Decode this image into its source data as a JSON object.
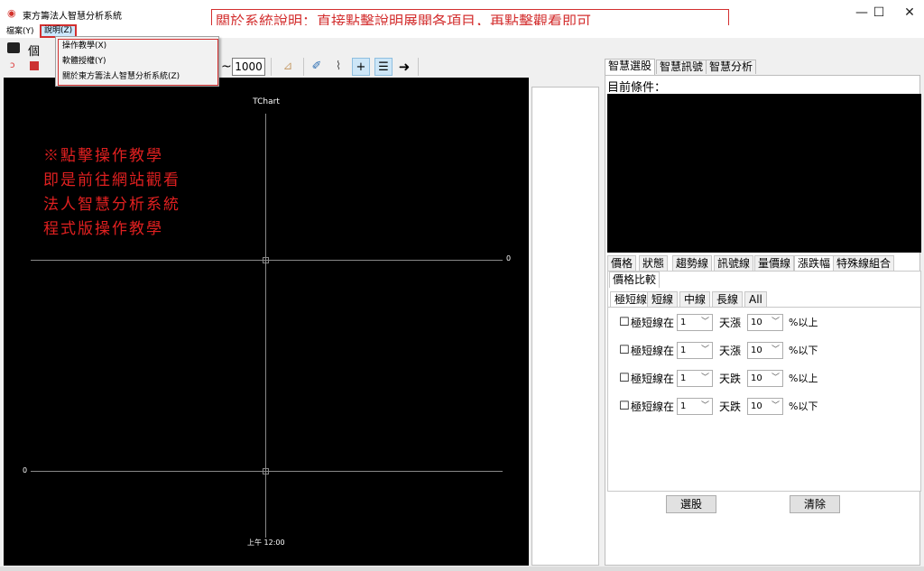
{
  "window": {
    "title": "東方籌法人智慧分析系統",
    "minimize": "—",
    "maximize": "☐",
    "close": "✕"
  },
  "callout": "關於系統說明：直接點擊說明展開各項目，再點擊觀看即可",
  "menubar": {
    "view": "檔案(Y)",
    "help": "說明(Z)"
  },
  "help_menu": {
    "items": [
      "操作教學(X)",
      "軟體授權(Y)",
      "關於東方籌法人智慧分析系統(Z)"
    ]
  },
  "toolbar": {
    "label": "個",
    "zoom_value": "1000",
    "nav_left": "<"
  },
  "chart": {
    "title": "TChart",
    "y_right_label": "0",
    "y_left_label": "0",
    "x_label": "上午 12:00",
    "note_lines": [
      "※點擊操作教學",
      "即是前往網站觀看",
      "法人智慧分析系統",
      "程式版操作教學"
    ]
  },
  "right": {
    "tabs": [
      "智慧選股",
      "智慧訊號",
      "智慧分析"
    ],
    "condition_label": "目前條件：",
    "category_tabs": [
      "價格",
      "狀態",
      "趨勢線",
      "訊號線",
      "量價線",
      "漲跌幅",
      "特殊線組合"
    ],
    "selected_category": "漲跌幅",
    "sub_tab": "價格比較",
    "line_tabs": [
      "極短線",
      "短線",
      "中線",
      "長線",
      "All"
    ],
    "selected_line_tab": "極短線",
    "rows": [
      {
        "label": "極短線在",
        "days": "1",
        "direction": "天漲",
        "pct": "10",
        "compare": "%以上"
      },
      {
        "label": "極短線在",
        "days": "1",
        "direction": "天漲",
        "pct": "10",
        "compare": "%以下"
      },
      {
        "label": "極短線在",
        "days": "1",
        "direction": "天跌",
        "pct": "10",
        "compare": "%以上"
      },
      {
        "label": "極短線在",
        "days": "1",
        "direction": "天跌",
        "pct": "10",
        "compare": "%以下"
      }
    ],
    "select_button": "選股",
    "clear_button": "清除"
  }
}
